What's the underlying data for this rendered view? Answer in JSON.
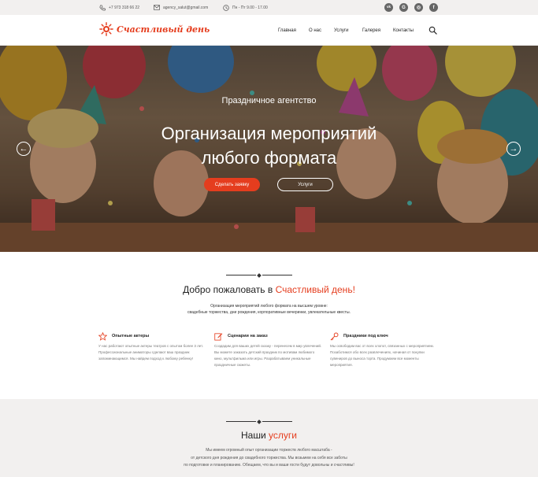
{
  "topbar": {
    "phone": "+7 973 318 66 22",
    "email": "agency_salut@gmail.com",
    "hours": "Пн - Пт 9.00 - 17.00",
    "social": [
      {
        "name": "vk",
        "glyph": "vk"
      },
      {
        "name": "google-plus",
        "glyph": "G"
      },
      {
        "name": "instagram",
        "glyph": "◎"
      },
      {
        "name": "facebook",
        "glyph": "f"
      }
    ]
  },
  "header": {
    "logo_text": "Счастливый день",
    "nav": [
      "Главная",
      "О нас",
      "Услуги",
      "Галерея",
      "Контакты"
    ]
  },
  "hero": {
    "subtitle": "Праздничное агентство",
    "title_line1": "Организация мероприятий",
    "title_line2": "любого формата",
    "btn_order": "Сделать заявку",
    "btn_services": "Услуги",
    "prev_arrow": "←",
    "next_arrow": "→"
  },
  "welcome": {
    "title_prefix": "Добро пожаловать в ",
    "title_accent": "Счастливый день!",
    "desc_line1": "Организация мероприятий любого формата на высшем уровне:",
    "desc_line2": "свадебные торжества, дни рождения, корпоративные вечеринки, увлекательные квесты."
  },
  "features": [
    {
      "icon": "star-icon",
      "title": "Опытные актеры",
      "text": "У нас работают опытные актеры театров с опытом более 3 лет. Профессиональные аниматоры сделают ваш праздник запоминающимся. Мы найдем подход к любому ребенку!"
    },
    {
      "icon": "edit-icon",
      "title": "Сценарии на заказ",
      "text": "Создадим для ваших детей сказку - перенесем в мир увлечений. Вы можете заказать детский праздник по мотивам любимого кино, мультфильма или игры. Разрабатываем уникальные праздничные сюжеты."
    },
    {
      "icon": "key-icon",
      "title": "Праздники под ключ",
      "text": "Мы освободим вас от всех хлопот, связанных с мероприятием. Позаботимся обо всех развлечениях, начиная от покупки сувениров до выноса торта. Продумаем все моменты мероприятия."
    }
  ],
  "services": {
    "title_prefix": "Наши ",
    "title_accent": "услуги",
    "desc_line1": "Мы имеем огромный опыт организации торжеств любого масштаба -",
    "desc_line2": "от детского дня рождения до свадебного торжества. Мы возьмем на себя все заботы",
    "desc_line3": "по подготовке и планированию. Обещаем, что вы и ваши гости будут довольны и счастливы!"
  },
  "colors": {
    "accent": "#e53d1e",
    "topbar_bg": "#f2f0ef",
    "social_bg": "#666666"
  }
}
